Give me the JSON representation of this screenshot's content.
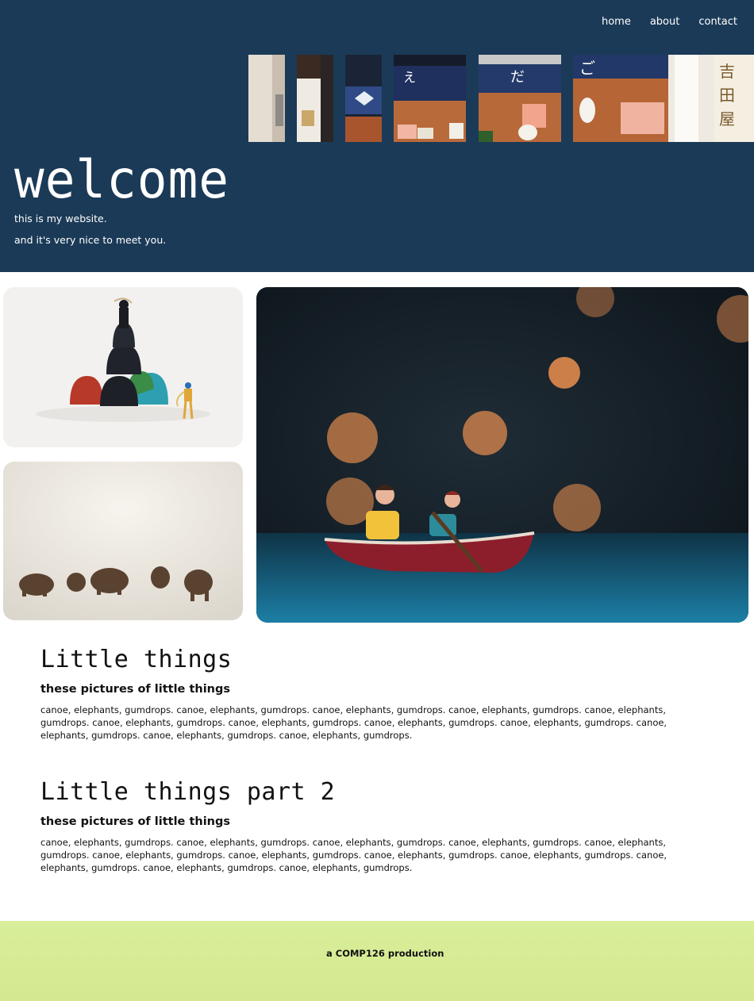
{
  "nav": {
    "home": "home",
    "about": "about",
    "contact": "contact"
  },
  "hero": {
    "title": "welcome",
    "line1": "this is my website.",
    "line2": "and it's very nice to meet you."
  },
  "sections": [
    {
      "title": "Little things",
      "subtitle": "these pictures of little things",
      "body": "canoe, elephants, gumdrops. canoe, elephants, gumdrops. canoe, elephants, gumdrops. canoe, elephants, gumdrops. canoe, elephants, gumdrops. canoe, elephants, gumdrops. canoe, elephants, gumdrops. canoe, elephants, gumdrops. canoe, elephants, gumdrops. canoe, elephants, gumdrops. canoe, elephants, gumdrops. canoe, elephants, gumdrops."
    },
    {
      "title": "Little things part 2",
      "subtitle": "these pictures of little things",
      "body": "canoe, elephants, gumdrops. canoe, elephants, gumdrops. canoe, elephants, gumdrops. canoe, elephants, gumdrops. canoe, elephants, gumdrops. canoe, elephants, gumdrops. canoe, elephants, gumdrops. canoe, elephants, gumdrops. canoe, elephants, gumdrops. canoe, elephants, gumdrops. canoe, elephants, gumdrops. canoe, elephants, gumdrops."
    }
  ],
  "footer": {
    "text": "a COMP126 production"
  },
  "colors": {
    "hero_bg": "#1b3a57",
    "footer_bg": "#d9ee9a",
    "text": "#111111"
  }
}
